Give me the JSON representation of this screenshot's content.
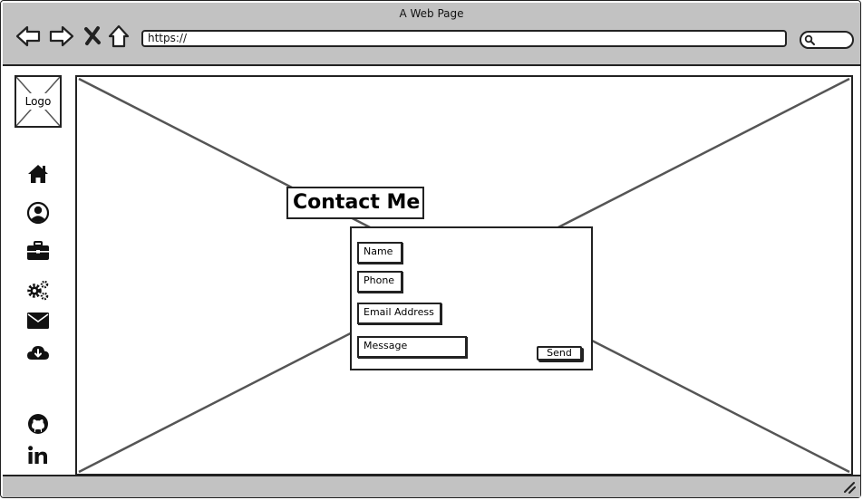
{
  "window": {
    "title": "A Web Page"
  },
  "toolbar": {
    "buttons": [
      {
        "name": "back",
        "icon": "back-arrow-icon"
      },
      {
        "name": "forward",
        "icon": "forward-arrow-icon"
      },
      {
        "name": "stop",
        "icon": "close-icon"
      },
      {
        "name": "home",
        "icon": "home-icon"
      }
    ],
    "url": "https://",
    "search_icon": "search-icon"
  },
  "sidebar": {
    "logo_label": "Logo",
    "nav_icons": [
      "home-icon",
      "user-circle-icon",
      "briefcase-icon",
      "cogs-icon",
      "envelope-icon",
      "cloud-download-icon"
    ],
    "social_icons": [
      "github-icon",
      "linkedin-icon"
    ]
  },
  "main": {
    "heading": "Contact Me",
    "form": {
      "name_field": "Name",
      "phone_field": "Phone",
      "email_field": "Email Address",
      "message_field": "Message",
      "send_label": "Send"
    }
  },
  "colors": {
    "chrome": "#c2c2c2",
    "stroke": "#222222",
    "placeholder_lines": "#555555"
  }
}
